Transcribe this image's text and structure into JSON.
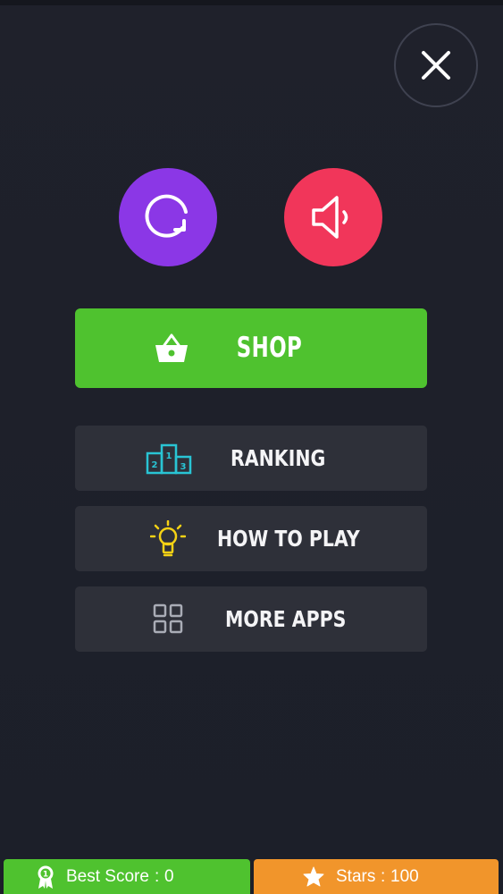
{
  "icons": {
    "close": "close-icon",
    "restart": "restart-icon",
    "sound": "speaker-icon",
    "shop": "basket-icon",
    "ranking": "podium-icon",
    "how_to_play": "lightbulb-icon",
    "more_apps": "grid-icon",
    "best_score": "medal-icon",
    "stars": "star-icon"
  },
  "colors": {
    "background": "#1e2029",
    "restart": "#8b37e6",
    "sound": "#f1365a",
    "shop": "#4fc22f",
    "menu_button": "#2e3039",
    "ranking_icon": "#29c4d4",
    "how_to_play_icon": "#f5d215",
    "best_score_bar": "#4fc22f",
    "stars_bar": "#f1952b"
  },
  "menu": {
    "shop_label": "SHOP",
    "ranking_label": "RANKING",
    "how_to_play_label": "HOW TO PLAY",
    "more_apps_label": "MORE APPS"
  },
  "ranking_icon_numbers": [
    "2",
    "1",
    "3"
  ],
  "footer": {
    "best_score_label": "Best Score",
    "best_score_value": "0",
    "stars_label": "Stars",
    "stars_value": "100",
    "separator": ":",
    "medal_number": "1"
  }
}
